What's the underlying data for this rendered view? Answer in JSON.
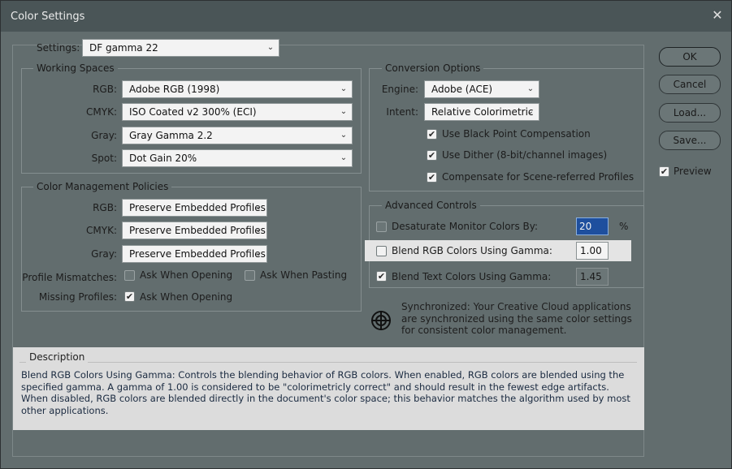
{
  "window": {
    "title": "Color Settings"
  },
  "settings": {
    "label": "Settings:",
    "value": "DF gamma 22"
  },
  "working_spaces": {
    "title": "Working Spaces",
    "rows": [
      {
        "label": "RGB:",
        "value": "Adobe RGB (1998)"
      },
      {
        "label": "CMYK:",
        "value": "ISO Coated v2 300% (ECI)"
      },
      {
        "label": "Gray:",
        "value": "Gray Gamma 2.2"
      },
      {
        "label": "Spot:",
        "value": "Dot Gain 20%"
      }
    ]
  },
  "policies": {
    "title": "Color Management Policies",
    "rows": [
      {
        "label": "RGB:",
        "value": "Preserve Embedded Profiles"
      },
      {
        "label": "CMYK:",
        "value": "Preserve Embedded Profiles"
      },
      {
        "label": "Gray:",
        "value": "Preserve Embedded Profiles"
      }
    ],
    "profile_mismatches": {
      "label": "Profile Mismatches:",
      "ask_opening": {
        "label": "Ask When Opening",
        "checked": false
      },
      "ask_pasting": {
        "label": "Ask When Pasting",
        "checked": false
      }
    },
    "missing_profiles": {
      "label": "Missing Profiles:",
      "ask_opening": {
        "label": "Ask When Opening",
        "checked": true
      }
    }
  },
  "conversion": {
    "title": "Conversion Options",
    "engine": {
      "label": "Engine:",
      "value": "Adobe (ACE)"
    },
    "intent": {
      "label": "Intent:",
      "value": "Relative Colorimetric"
    },
    "options": [
      {
        "label": "Use Black Point Compensation",
        "checked": true
      },
      {
        "label": "Use Dither (8-bit/channel images)",
        "checked": true
      },
      {
        "label": "Compensate for Scene-referred Profiles",
        "checked": true
      }
    ]
  },
  "advanced": {
    "title": "Advanced Controls",
    "desaturate": {
      "label": "Desaturate Monitor Colors By:",
      "value": "20",
      "unit": "%",
      "checked": false
    },
    "blend_rgb": {
      "label": "Blend RGB Colors Using Gamma:",
      "value": "1.00",
      "checked": false
    },
    "blend_text": {
      "label": "Blend Text Colors Using Gamma:",
      "value": "1.45",
      "checked": true
    }
  },
  "sync": {
    "text": "Synchronized: Your Creative Cloud applications are synchronized using the same color settings for consistent color management."
  },
  "description": {
    "title": "Description",
    "text": "Blend RGB Colors Using Gamma:  Controls the blending behavior of RGB colors.  When enabled, RGB colors are blended using the specified gamma.  A gamma of 1.00 is considered to be \"colorimetricly correct\" and should result in the fewest edge artifacts.  When disabled, RGB colors are blended directly in the document's color space; this behavior matches the algorithm used by most other applications."
  },
  "buttons": {
    "ok": "OK",
    "cancel": "Cancel",
    "load": "Load...",
    "save": "Save...",
    "preview": {
      "label": "Preview",
      "checked": true
    }
  },
  "icons": {
    "close": "close-icon",
    "chevron": "chevron-down-icon",
    "sync": "sync-target-icon",
    "check": "checkmark-icon"
  },
  "colors": {
    "dialog_bg": "#626d6e",
    "titlebar": "#4a5557",
    "accent_selection": "#1e4f9e",
    "description_bg": "#dcdcdc"
  }
}
